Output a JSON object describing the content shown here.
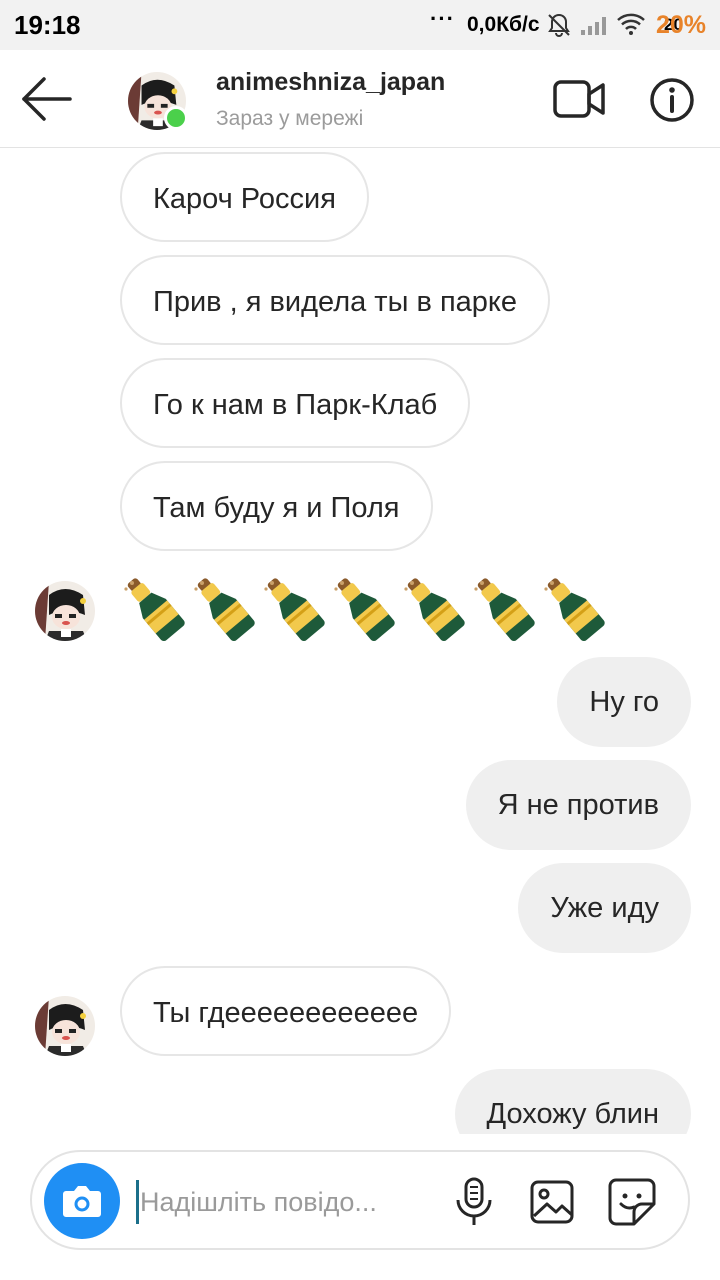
{
  "status_bar": {
    "time": "19:18",
    "dots": "···",
    "speed": "0,0Кб/с",
    "battery_small": "20",
    "battery": "20%",
    "battery_color": "#e8832a"
  },
  "header": {
    "back_icon": "arrow-left-icon",
    "contact_name": "animeshniza_japan",
    "contact_status": "Зараз у мережі",
    "online_color": "#4bd04b",
    "video_icon": "video-camera-icon",
    "info_icon": "info-icon"
  },
  "messages": {
    "incoming_1": "Кароч Россия",
    "incoming_2": "Прив , я видела ты в парке",
    "incoming_3": "Го к нам в Парк-Клаб",
    "incoming_4": "Там буду я и Поля",
    "emoji_row": [
      "🍾",
      "🍾",
      "🍾",
      "🍾",
      "🍾",
      "🍾",
      "🍾"
    ],
    "outgoing_1": "Ну го",
    "outgoing_2": "Я не против",
    "outgoing_3": "Уже иду",
    "incoming_5": "Ты гдееееееееееее",
    "outgoing_4": "Дохожу блин"
  },
  "composer": {
    "placeholder": "Надішліть повідо...",
    "value": "",
    "camera_icon": "camera-icon",
    "mic_icon": "microphone-icon",
    "gallery_icon": "image-icon",
    "sticker_icon": "sticker-icon",
    "accent_color": "#1f8ff4"
  }
}
